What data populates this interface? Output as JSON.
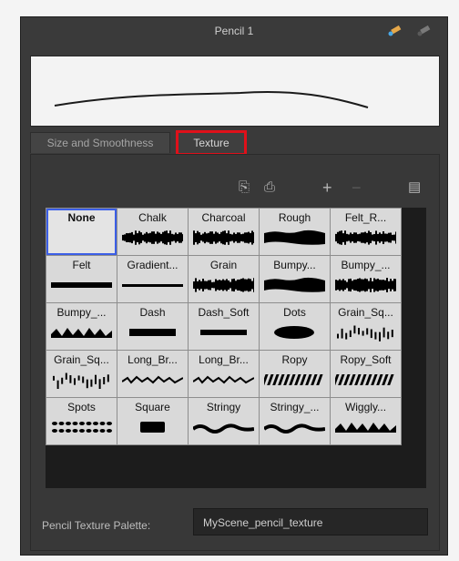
{
  "window": {
    "title": "Pencil 1"
  },
  "tabs": [
    {
      "label": "Size and Smoothness"
    },
    {
      "label": "Texture"
    }
  ],
  "toolbar": {
    "icons": [
      "load-texture-icon",
      "save-texture-icon",
      "add-texture-icon",
      "remove-texture-icon",
      "menu-icon"
    ]
  },
  "textures": [
    {
      "name": "None",
      "selected": true
    },
    {
      "name": "Chalk"
    },
    {
      "name": "Charcoal"
    },
    {
      "name": "Rough"
    },
    {
      "name": "Felt_R..."
    },
    {
      "name": "Felt"
    },
    {
      "name": "Gradient..."
    },
    {
      "name": "Grain"
    },
    {
      "name": "Bumpy..."
    },
    {
      "name": "Bumpy_..."
    },
    {
      "name": "Bumpy_..."
    },
    {
      "name": "Dash"
    },
    {
      "name": "Dash_Soft"
    },
    {
      "name": "Dots"
    },
    {
      "name": "Grain_Sq..."
    },
    {
      "name": "Grain_Sq..."
    },
    {
      "name": "Long_Br..."
    },
    {
      "name": "Long_Br..."
    },
    {
      "name": "Ropy"
    },
    {
      "name": "Ropy_Soft"
    },
    {
      "name": "Spots"
    },
    {
      "name": "Square"
    },
    {
      "name": "Stringy"
    },
    {
      "name": "Stringy_..."
    },
    {
      "name": "Wiggly..."
    }
  ],
  "palette": {
    "label": "Pencil Texture Palette:",
    "value": "MyScene_pencil_texture"
  },
  "colors": {
    "panel": "#3a3a3a",
    "highlight": "#e0101a",
    "selection": "#3b5ee6"
  }
}
